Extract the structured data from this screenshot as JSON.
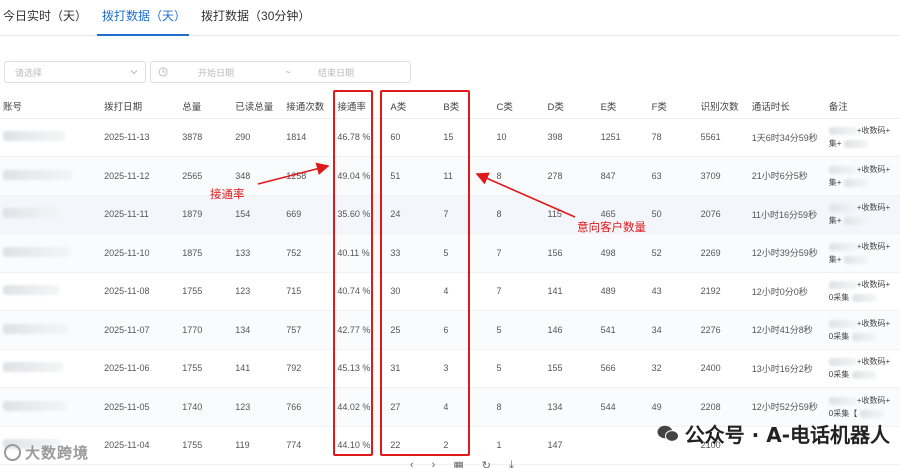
{
  "tabs": [
    {
      "label": "今日实时（天）",
      "active": false
    },
    {
      "label": "拨打数据（天）",
      "active": true
    },
    {
      "label": "拨打数据（30分钟）",
      "active": false
    }
  ],
  "filters": {
    "select_placeholder": "请选择",
    "date_start_placeholder": "开始日期",
    "date_separator": "~",
    "date_end_placeholder": "结束日期"
  },
  "table": {
    "headers": [
      "账号",
      "拨打日期",
      "总量",
      "已读总量",
      "接通次数",
      "接通率",
      "A类",
      "B类",
      "C类",
      "D类",
      "E类",
      "F类",
      "识别次数",
      "通话时长",
      "备注"
    ],
    "rows": [
      {
        "date": "2025-11-13",
        "total": "3878",
        "read": "290",
        "connects": "1814",
        "rate": "46.78 %",
        "a": "60",
        "b": "15",
        "c": "10",
        "d": "398",
        "e": "1251",
        "f": "78",
        "recog": "5561",
        "duration": "1天6时34分59秒",
        "note1": "+收数码+",
        "note2": "集+"
      },
      {
        "date": "2025-11-12",
        "total": "2565",
        "read": "348",
        "connects": "1258",
        "rate": "49.04 %",
        "a": "51",
        "b": "11",
        "c": "8",
        "d": "278",
        "e": "847",
        "f": "63",
        "recog": "3709",
        "duration": "21小时6分5秒",
        "note1": "+收数码+",
        "note2": "集+"
      },
      {
        "date": "2025-11-11",
        "total": "1879",
        "read": "154",
        "connects": "669",
        "rate": "35.60 %",
        "a": "24",
        "b": "7",
        "c": "8",
        "d": "115",
        "e": "465",
        "f": "50",
        "recog": "2076",
        "duration": "11小时16分59秒",
        "note1": "+收数码+",
        "note2": "集+"
      },
      {
        "date": "2025-11-10",
        "total": "1875",
        "read": "133",
        "connects": "752",
        "rate": "40.11 %",
        "a": "33",
        "b": "5",
        "c": "7",
        "d": "156",
        "e": "498",
        "f": "52",
        "recog": "2269",
        "duration": "12小时39分59秒",
        "note1": "+收数码+",
        "note2": "集+"
      },
      {
        "date": "2025-11-08",
        "total": "1755",
        "read": "123",
        "connects": "715",
        "rate": "40.74 %",
        "a": "30",
        "b": "4",
        "c": "7",
        "d": "141",
        "e": "489",
        "f": "43",
        "recog": "2192",
        "duration": "12小时0分0秒",
        "note1": "+收数码+",
        "note2": "0采集"
      },
      {
        "date": "2025-11-07",
        "total": "1770",
        "read": "134",
        "connects": "757",
        "rate": "42.77 %",
        "a": "25",
        "b": "6",
        "c": "5",
        "d": "146",
        "e": "541",
        "f": "34",
        "recog": "2276",
        "duration": "12小时41分8秒",
        "note1": "+收数码+",
        "note2": "0采集"
      },
      {
        "date": "2025-11-06",
        "total": "1755",
        "read": "141",
        "connects": "792",
        "rate": "45.13 %",
        "a": "31",
        "b": "3",
        "c": "5",
        "d": "155",
        "e": "566",
        "f": "32",
        "recog": "2400",
        "duration": "13小时16分2秒",
        "note1": "+收数码+",
        "note2": "0采集"
      },
      {
        "date": "2025-11-05",
        "total": "1740",
        "read": "123",
        "connects": "766",
        "rate": "44.02 %",
        "a": "27",
        "b": "4",
        "c": "8",
        "d": "134",
        "e": "544",
        "f": "49",
        "recog": "2208",
        "duration": "12小时52分59秒",
        "note1": "+收数码+",
        "note2": "0采集【"
      },
      {
        "date": "2025-11-04",
        "total": "1755",
        "read": "119",
        "connects": "774",
        "rate": "44.10 %",
        "a": "22",
        "b": "2",
        "c": "1",
        "d": "147",
        "e": "",
        "f": "",
        "recog": "2100",
        "duration": "",
        "note1": "",
        "note2": ""
      }
    ]
  },
  "annotations": {
    "rate_label": "接通率",
    "intent_label": "意向客户数量",
    "color": "#e0191b"
  },
  "watermarks": {
    "left": "大数跨境",
    "right": "公众号 · A-电话机器人"
  }
}
